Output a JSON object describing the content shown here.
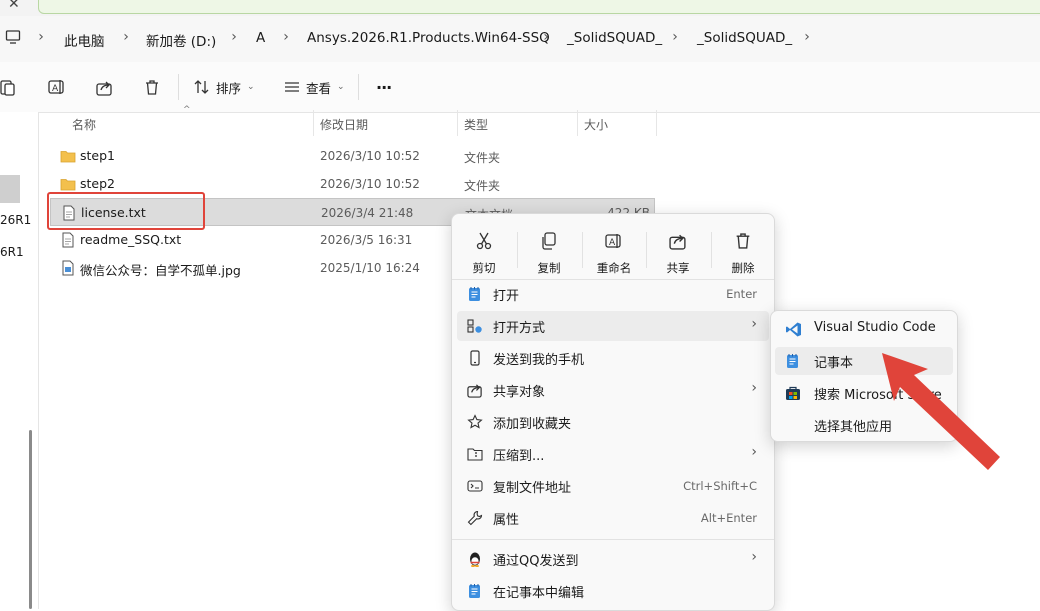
{
  "window": {
    "close_glyph": "✕"
  },
  "address_bar": {
    "crumbs": [
      "此电脑",
      "新加卷 (D:)",
      "A",
      "Ansys.2026.R1.Products.Win64-SSQ",
      "_SolidSQUAD_",
      "_SolidSQUAD_"
    ]
  },
  "toolbar": {
    "sort_label": "排序",
    "view_label": "查看",
    "more_label": "···"
  },
  "nav": {
    "items": [
      "26R1",
      "6R1"
    ]
  },
  "columns": {
    "name": "名称",
    "modified": "修改日期",
    "type": "类型",
    "size": "大小"
  },
  "files": [
    {
      "name": "step1",
      "date": "2026/3/10 10:52",
      "type": "文件夹",
      "size": "",
      "icon": "folder-icon"
    },
    {
      "name": "step2",
      "date": "2026/3/10 10:52",
      "type": "文件夹",
      "size": "",
      "icon": "folder-icon"
    },
    {
      "name": "license.txt",
      "date": "2026/3/4 21:48",
      "type": "文本文档",
      "size": "422 KB",
      "icon": "text-file-icon"
    },
    {
      "name": "readme_SSQ.txt",
      "date": "2026/3/5 16:31",
      "type": "",
      "size": "",
      "icon": "text-file-icon"
    },
    {
      "name": "微信公众号：自学不孤单.jpg",
      "date": "2025/1/10 16:24",
      "type": "",
      "size": "",
      "icon": "image-file-icon"
    }
  ],
  "context_menu": {
    "quick_actions": [
      "剪切",
      "复制",
      "重命名",
      "共享",
      "删除"
    ],
    "items": [
      {
        "label": "打开",
        "shortcut": "Enter",
        "icon": "notepad-icon"
      },
      {
        "label": "打开方式",
        "submenu": true,
        "icon": "open-with-icon"
      },
      {
        "label": "发送到我的手机",
        "icon": "phone-icon"
      },
      {
        "label": "共享对象",
        "submenu": true,
        "icon": "share-icon"
      },
      {
        "label": "添加到收藏夹",
        "icon": "star-icon"
      },
      {
        "label": "压缩到...",
        "submenu": true,
        "icon": "zip-icon"
      },
      {
        "label": "复制文件地址",
        "shortcut": "Ctrl+Shift+C",
        "icon": "copy-path-icon"
      },
      {
        "label": "属性",
        "shortcut": "Alt+Enter",
        "icon": "wrench-icon"
      },
      {
        "label": "通过QQ发送到",
        "submenu": true,
        "icon": "qq-icon"
      },
      {
        "label": "在记事本中编辑",
        "icon": "notepad-icon"
      }
    ]
  },
  "submenu": {
    "items": [
      {
        "label": "Visual Studio Code",
        "icon": "vscode-icon"
      },
      {
        "label": "记事本",
        "icon": "notepad-icon"
      },
      {
        "label": "搜索 Microsoft Store",
        "icon": "store-icon"
      },
      {
        "label": "选择其他应用",
        "icon": ""
      }
    ]
  },
  "colors": {
    "highlight_red": "#e0443a",
    "folder_yellow": "#f3c04d",
    "vscode_blue": "#2f7fd1"
  }
}
